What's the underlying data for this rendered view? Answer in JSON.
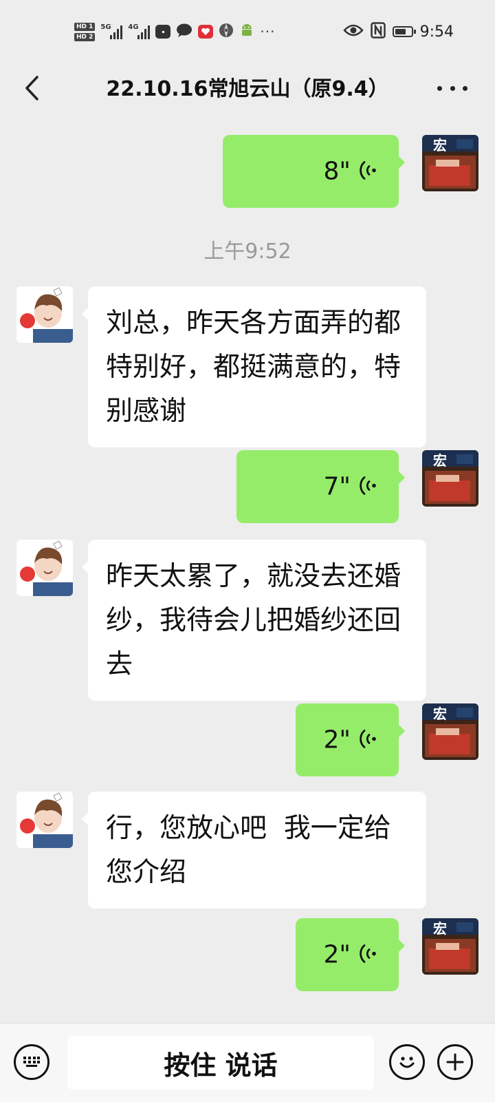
{
  "status_bar": {
    "hd1": "HD 1",
    "hd2": "HD 2",
    "net1": "5G",
    "net2": "4G",
    "overflow": "···",
    "time": "9:54",
    "icons": [
      "hd-icon",
      "signal-5g-icon",
      "signal-4g-icon",
      "huawei-app-icon",
      "chat-bubble-icon",
      "red-heart-app-icon",
      "browser-app-icon",
      "android-icon",
      "eye-icon",
      "nfc-icon",
      "battery-icon"
    ]
  },
  "header": {
    "title": "22.10.16常旭云山（原9.4）"
  },
  "messages": [
    {
      "type": "voice",
      "dir": "out",
      "duration": "8\""
    },
    {
      "type": "time",
      "text": "上午9:52"
    },
    {
      "type": "text",
      "dir": "in",
      "text": "刘总，昨天各方面弄的都特别好，都挺满意的，特别感谢"
    },
    {
      "type": "voice",
      "dir": "out",
      "duration": "7\""
    },
    {
      "type": "text",
      "dir": "in",
      "text": "昨天太累了，就没去还婚纱，我待会儿把婚纱还回去"
    },
    {
      "type": "voice",
      "dir": "out",
      "duration": "2\""
    },
    {
      "type": "text",
      "dir": "in",
      "text": "行，您放心吧  我一定给您介绍"
    },
    {
      "type": "voice",
      "dir": "out",
      "duration": "2\""
    }
  ],
  "input_bar": {
    "hold_to_talk_label": "按住 说话",
    "icons": [
      "keyboard-icon",
      "emoji-icon",
      "plus-icon"
    ]
  },
  "colors": {
    "background": "#ededed",
    "outgoing_bubble": "#95ec69",
    "incoming_bubble": "#ffffff",
    "timestamp": "#999999"
  }
}
